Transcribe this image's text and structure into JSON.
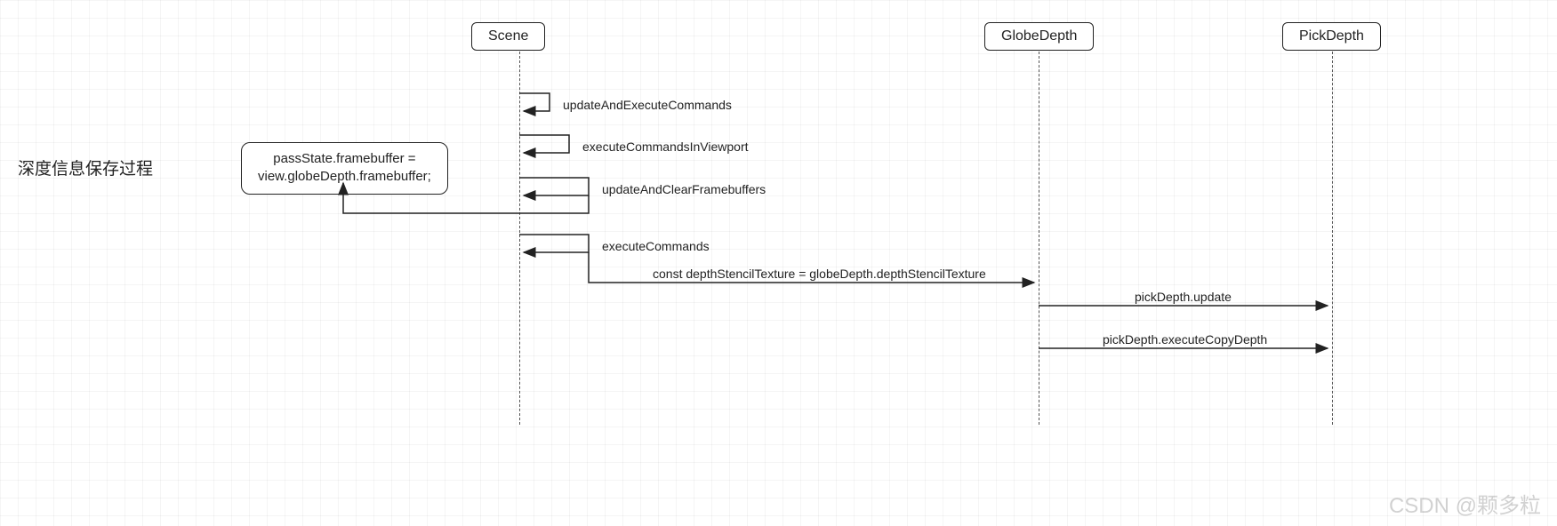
{
  "title": "深度信息保存过程",
  "participants": {
    "scene": "Scene",
    "globeDepth": "GlobeDepth",
    "pickDepth": "PickDepth"
  },
  "note": {
    "line1": "passState.framebuffer =",
    "line2": "view.globeDepth.framebuffer;"
  },
  "messages": {
    "m1": "updateAndExecuteCommands",
    "m2": "executeCommandsInViewport",
    "m3": "updateAndClearFramebuffers",
    "m4": "executeCommands",
    "m5": "const depthStencilTexture = globeDepth.depthStencilTexture",
    "m6": "pickDepth.update",
    "m7": "pickDepth.executeCopyDepth"
  },
  "watermark": "CSDN @颗多粒"
}
